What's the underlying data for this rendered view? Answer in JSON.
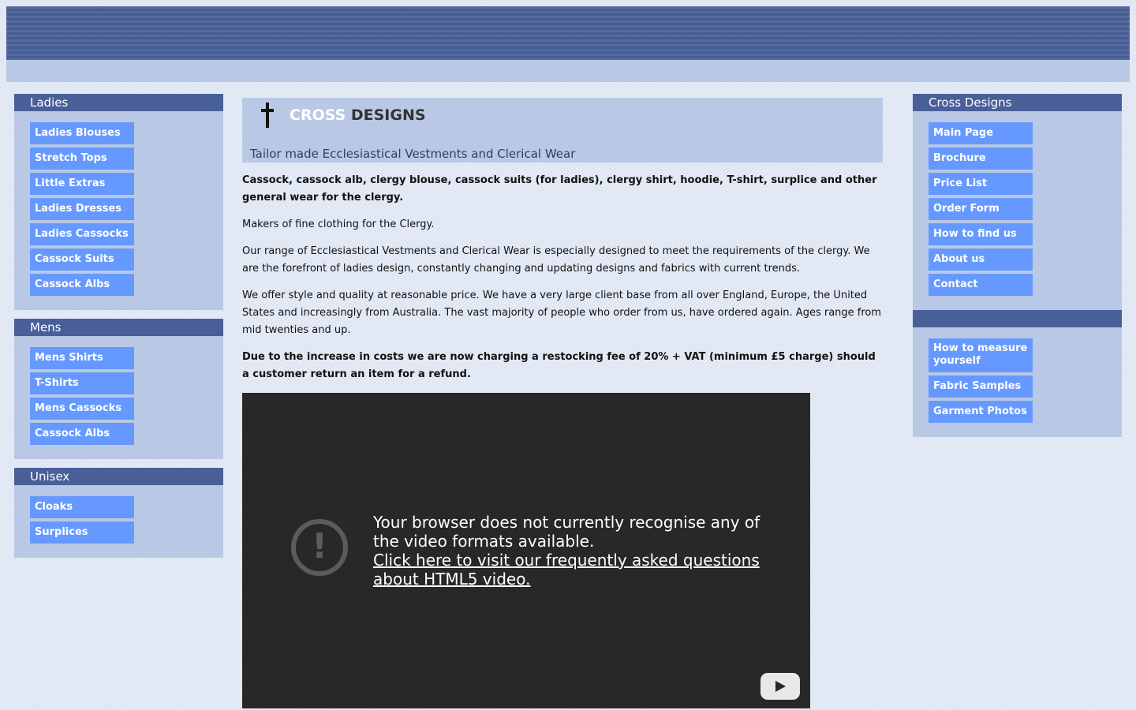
{
  "left_sidebar": {
    "sections": [
      {
        "title": "Ladies",
        "items": [
          "Ladies Blouses",
          "Stretch Tops",
          "Little Extras",
          "Ladies Dresses",
          "Ladies Cassocks",
          "Cassock Suits",
          "Cassock Albs"
        ]
      },
      {
        "title": "Mens",
        "items": [
          "Mens Shirts",
          "T-Shirts",
          "Mens Cassocks",
          "Cassock Albs"
        ]
      },
      {
        "title": "Unisex",
        "items": [
          "Cloaks",
          "Surplices"
        ]
      }
    ]
  },
  "right_sidebar": {
    "title": "Cross Designs",
    "items": [
      "Main Page",
      "Brochure",
      "Price List",
      "Order Form",
      "How to find us",
      "About us",
      "Contact"
    ],
    "extra_items": [
      "How to measure yourself",
      "Fabric Samples",
      "Garment Photos"
    ]
  },
  "header": {
    "brand_word1": "CROSS",
    "brand_word2": "DESIGNS",
    "tagline": "Tailor made Ecclesiastical Vestments and Clerical Wear"
  },
  "content": {
    "intro_bold": "Cassock, cassock alb, clergy blouse, cassock suits (for ladies), clergy shirt, hoodie, T-shirt, surplice and other general wear for the clergy.",
    "para1": "Makers of fine clothing for the Clergy.",
    "para2": "Our range of Ecclesiastical Vestments and Clerical Wear is especially designed to meet the requirements of the clergy. We are the forefront of ladies design, constantly changing and updating designs and fabrics with current trends.",
    "para3": "We offer style and quality at reasonable price. We have a very large client base from all over England, Europe, the United States and increasingly from Australia. The vast majority of people who order from us, have ordered again. Ages range from mid twenties and up.",
    "notice_bold": "Due to the increase in costs we are now charging a restocking fee of 20% + VAT (minimum £5 charge) should a customer return an item for a refund."
  },
  "video": {
    "message": "Your browser does not currently recognise any of the video formats available.",
    "link_text": "Click here to visit our frequently asked questions about HTML5 video."
  },
  "colors": {
    "banner": "#4a6198",
    "panel": "#b9c9e5",
    "panel_title": "#485f98",
    "nav_button": "#6699ff",
    "video_bg": "#282828"
  }
}
